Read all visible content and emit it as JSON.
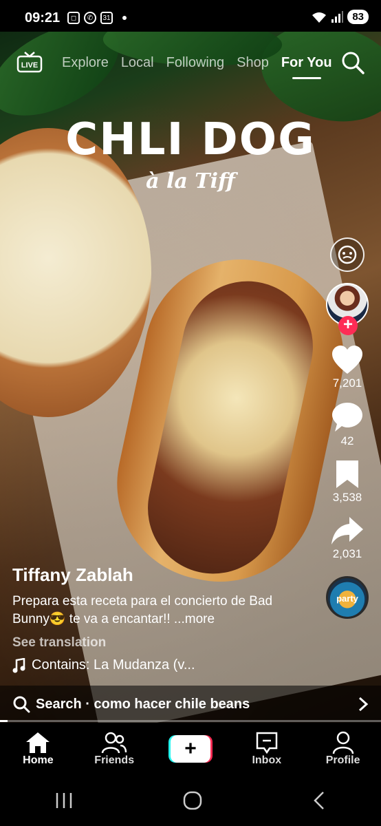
{
  "status_bar": {
    "time": "09:21",
    "battery": "83",
    "notification_icons": [
      "screenshot-icon",
      "whatsapp-icon",
      "calendar-icon"
    ],
    "calendar_day": "31"
  },
  "top_nav": {
    "live_label": "LIVE",
    "tabs": [
      {
        "label": "Explore",
        "active": false
      },
      {
        "label": "Local",
        "active": false
      },
      {
        "label": "Following",
        "active": false
      },
      {
        "label": "Shop",
        "active": false
      },
      {
        "label": "For You",
        "active": true
      }
    ]
  },
  "video": {
    "overlay_title": "CHLI DOG",
    "overlay_subtitle": "à la Tiff"
  },
  "actions": {
    "likes": "7,201",
    "comments": "42",
    "saves": "3,538",
    "shares": "2,031",
    "follow_symbol": "+",
    "music_disc_label": "party tyme"
  },
  "caption": {
    "author": "Tiffany Zablah",
    "description": "Prepara esta receta para el concierto de Bad Bunny😎 te va a encantar!! ...more",
    "see_translation": "See translation",
    "sound": "Contains: La Mudanza (v..."
  },
  "search_suggestion": {
    "text": "Search · como hacer chile beans"
  },
  "progress": {
    "fraction": 0.02
  },
  "bottom_nav": {
    "items": [
      {
        "label": "Home",
        "active": true
      },
      {
        "label": "Friends",
        "active": false
      },
      {
        "label": "",
        "active": false
      },
      {
        "label": "Inbox",
        "active": false
      },
      {
        "label": "Profile",
        "active": false
      }
    ],
    "create_symbol": "+"
  },
  "colors": {
    "accent_red": "#fe2c55",
    "accent_cyan": "#25f4ee",
    "background": "#000000"
  }
}
